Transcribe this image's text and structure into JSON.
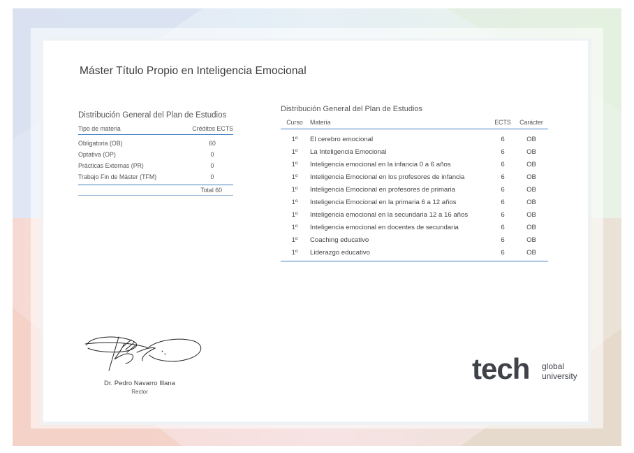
{
  "page": {
    "title": "Máster Título Propio en Inteligencia Emocional"
  },
  "summary": {
    "caption": "Distribución General del Plan de Estudios",
    "col_type": "Tipo de materia",
    "col_credits": "Créditos ECTS",
    "rows": [
      {
        "type": "Obligatoria (OB)",
        "credits": "60"
      },
      {
        "type": "Optativa (OP)",
        "credits": "0"
      },
      {
        "type": "Prácticas Externas (PR)",
        "credits": "0"
      },
      {
        "type": "Trabajo Fin de Máster (TFM)",
        "credits": "0"
      }
    ],
    "total": "Total 60"
  },
  "courses": {
    "caption": "Distribución General del Plan de Estudios",
    "col_course": "Curso",
    "col_subject": "Materia",
    "col_ects": "ECTS",
    "col_character": "Carácter",
    "rows": [
      {
        "course": "1º",
        "subject": "El cerebro emocional",
        "ects": "6",
        "character": "OB"
      },
      {
        "course": "1º",
        "subject": "La Inteligencia Emocional",
        "ects": "6",
        "character": "OB"
      },
      {
        "course": "1º",
        "subject": "Inteligencia emocional en la infancia 0 a 6 años",
        "ects": "6",
        "character": "OB"
      },
      {
        "course": "1º",
        "subject": "Inteligencia Emocional en los profesores de infancia",
        "ects": "6",
        "character": "OB"
      },
      {
        "course": "1º",
        "subject": "Inteligencia Emocional en profesores de primaria",
        "ects": "6",
        "character": "OB"
      },
      {
        "course": "1º",
        "subject": "Inteligencia Emocional en la primaria 6 a 12 años",
        "ects": "6",
        "character": "OB"
      },
      {
        "course": "1º",
        "subject": "Inteligencia emocional en la secundaria 12 a 16 años",
        "ects": "6",
        "character": "OB"
      },
      {
        "course": "1º",
        "subject": "Inteligencia emocional en docentes de secundaria",
        "ects": "6",
        "character": "OB"
      },
      {
        "course": "1º",
        "subject": "Coaching educativo",
        "ects": "6",
        "character": "OB"
      },
      {
        "course": "1º",
        "subject": "Liderazgo educativo",
        "ects": "6",
        "character": "OB"
      }
    ]
  },
  "signature": {
    "name": "Dr. Pedro Navarro Illana",
    "role": "Rector"
  },
  "logo": {
    "wordmark": "tech",
    "line1": "global",
    "line2": "university"
  },
  "colors": {
    "accent": "#3d7fbf",
    "text": "#3a3a3a",
    "logo": "#3f4349"
  }
}
